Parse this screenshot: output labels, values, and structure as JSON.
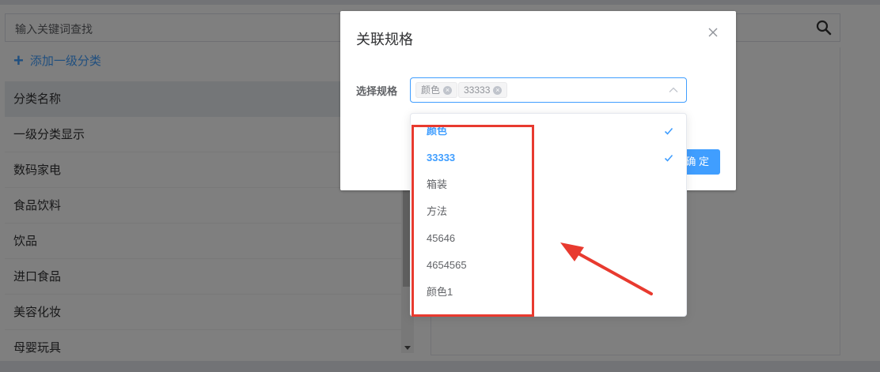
{
  "search": {
    "placeholder": "输入关键词查找"
  },
  "add_button": {
    "icon": "plus-icon",
    "label": "添加一级分类"
  },
  "category_list": {
    "header": "分类名称",
    "items": [
      "一级分类显示",
      "数码家电",
      "食品饮料",
      "饮品",
      "进口食品",
      "美容化妆",
      "母婴玩具"
    ]
  },
  "dialog": {
    "title": "关联规格",
    "form_label": "选择规格",
    "tags": [
      "颜色",
      "33333"
    ],
    "confirm_label": "确 定"
  },
  "dropdown": {
    "options": [
      {
        "label": "颜色",
        "selected": true
      },
      {
        "label": "33333",
        "selected": true
      },
      {
        "label": "箱装",
        "selected": false
      },
      {
        "label": "方法",
        "selected": false
      },
      {
        "label": "45646",
        "selected": false
      },
      {
        "label": "4654565",
        "selected": false
      },
      {
        "label": "颜色1",
        "selected": false
      }
    ]
  },
  "colors": {
    "accent": "#409eff",
    "annotation": "#e83a2f"
  }
}
